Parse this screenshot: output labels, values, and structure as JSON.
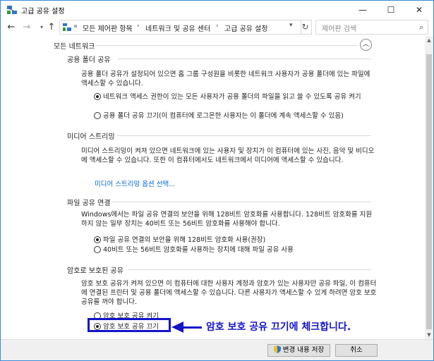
{
  "window": {
    "title": "고급 공유 설정"
  },
  "nav": {
    "history_marker": "«",
    "breadcrumbs": [
      "모든 제어판 항목",
      "네트워크 및 공유 센터",
      "고급 공유 설정"
    ],
    "search_placeholder": "제어판 검색"
  },
  "profile": {
    "title": "모든 네트워크"
  },
  "sections": {
    "public_folder": {
      "title": "공용 폴더 공유",
      "desc": "공용 폴더 공유가 설정되어 있으면 홈 그룹 구성원을 비롯한 네트워크 사용자가 공용 폴더에 있는 파일에 액세스할 수 있습니다.",
      "opt1": "네트워크 액세스 권한이 있는 모든 사용자가 공용 폴더의 파일을 읽고 쓸 수 있도록 공유 켜기",
      "opt2": "공용 폴더 공유 끄기(이 컴퓨터에 로그온한 사용자는 이 폴더에 계속 액세스할 수 있음)"
    },
    "media": {
      "title": "미디어 스트리밍",
      "desc": "미디어 스트리밍이 켜져 있으면 네트워크에 있는 사용자 및 장치가 이 컴퓨터에 있는 사진, 음악 및 비디오에 액세스할 수 있습니다. 또한 이 컴퓨터에서도 네트워크에서 미디어에 액세스할 수 있습니다.",
      "link": "미디어 스트리밍 옵션 선택..."
    },
    "file_sharing": {
      "title": "파일 공유 연결",
      "desc": "Windows에서는 파일 공유 연결의 보안을 위해 128비트 암호화를 사용합니다. 128비트 암호화를 지원하지 않는 일부 장치는 40비트 또는 56비트 암호화를 사용해야 합니다.",
      "opt1": "파일 공유 연결의 보안을 위해 128비트 암호화 사용(권장)",
      "opt2": "40비트 또는 56비트 암호화를 사용하는 장치에 대해 파일 공유 사용"
    },
    "password": {
      "title": "암호로 보호된 공유",
      "desc": "암호 보호 공유가 켜져 있으면 이 컴퓨터에 대한 사용자 계정과 암호가 있는 사용자만 공유 파일, 이 컴퓨터에 연결된 프린터 및 공용 폴더에 액세스할 수 있습니다. 다른 사용자가 액세스할 수 있게 하려면 암호 보호 공유를 꺼야 합니다.",
      "opt1": "암호 보호 공유 켜기",
      "opt2": "암호 보호 공유 끄기"
    }
  },
  "annotation": {
    "text": "암호 보호 공유 끄기에 체크합니다."
  },
  "footer": {
    "save_label": "변경 내용 저장",
    "cancel_label": "취소"
  },
  "colors": {
    "annotation": "#1414c8",
    "link": "#0066cc",
    "window_border": "#3c8ad8"
  }
}
